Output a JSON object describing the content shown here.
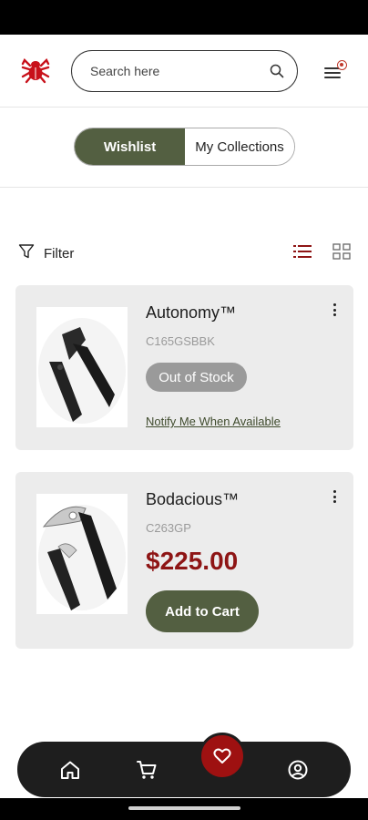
{
  "header": {
    "search_placeholder": "Search here",
    "notification_dot_color": "#c0392b",
    "logo_color": "#c8101a"
  },
  "tabs": [
    {
      "label": "Wishlist",
      "active": true
    },
    {
      "label": "My Collections",
      "active": false
    }
  ],
  "toolbar": {
    "filter_label": "Filter",
    "active_view": "list"
  },
  "products": [
    {
      "name": "Autonomy™",
      "sku": "C165GSBBK",
      "status_label": "Out of Stock",
      "notify_label": "Notify Me When Available"
    },
    {
      "name": "Bodacious™",
      "sku": "C263GP",
      "price": "$225.00",
      "add_to_cart_label": "Add to Cart"
    }
  ],
  "bottom_nav": {
    "items": [
      "home-icon",
      "cart-icon",
      "heart-icon",
      "account-icon"
    ],
    "active": "heart-icon",
    "accent": "#9e1111"
  },
  "colors": {
    "primary_green": "#535f41",
    "price_red": "#8e1515",
    "card_bg": "#ececec"
  }
}
